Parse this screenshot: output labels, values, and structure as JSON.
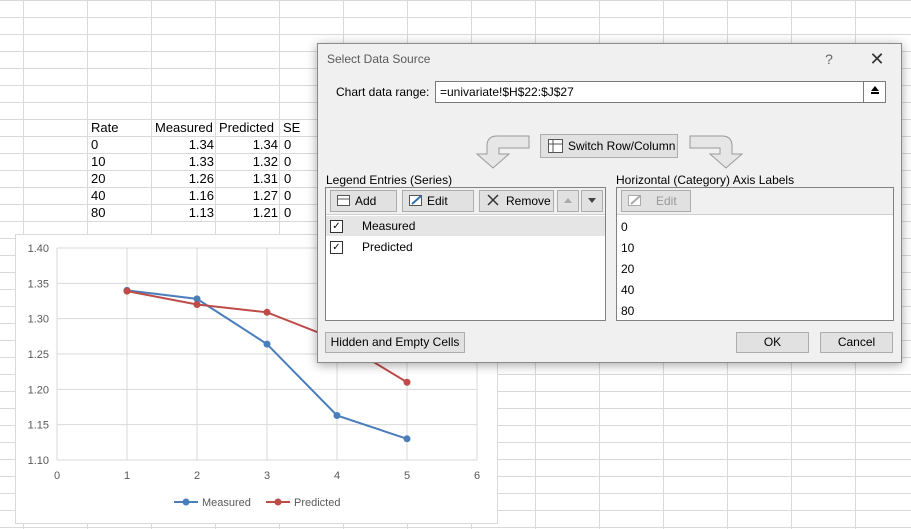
{
  "spreadsheet": {
    "headers": [
      "Rate",
      "Measured",
      "Predicted",
      "SE"
    ],
    "rows": [
      {
        "rate": "0",
        "measured": "1.34",
        "predicted": "1.34",
        "se": "0"
      },
      {
        "rate": "10",
        "measured": "1.33",
        "predicted": "1.32",
        "se": "0"
      },
      {
        "rate": "20",
        "measured": "1.26",
        "predicted": "1.31",
        "se": "0"
      },
      {
        "rate": "40",
        "measured": "1.16",
        "predicted": "1.27",
        "se": "0"
      },
      {
        "rate": "80",
        "measured": "1.13",
        "predicted": "1.21",
        "se": "0"
      }
    ]
  },
  "chart_data": {
    "type": "line",
    "x_ticks": [
      "0",
      "1",
      "2",
      "3",
      "4",
      "5",
      "6"
    ],
    "y_ticks": [
      "1.40",
      "1.35",
      "1.30",
      "1.25",
      "1.20",
      "1.15",
      "1.10"
    ],
    "xlim": [
      0,
      6
    ],
    "ylim": [
      1.1,
      1.4
    ],
    "grid": true,
    "legend": "bottom",
    "series": [
      {
        "name": "Measured",
        "color": "#4a7ebb",
        "x": [
          1,
          2,
          3,
          4,
          5
        ],
        "y": [
          1.34,
          1.328,
          1.264,
          1.163,
          1.13
        ]
      },
      {
        "name": "Predicted",
        "color": "#be4b48",
        "x": [
          1,
          2,
          3,
          4,
          5
        ],
        "y": [
          1.339,
          1.32,
          1.309,
          1.27,
          1.21
        ]
      }
    ]
  },
  "dialog": {
    "title": "Select Data Source",
    "help": "?",
    "close": "✕",
    "range_label": "Chart data range:",
    "range_value": "=univariate!$H$22:$J$27",
    "switch_label": "Switch Row/Column",
    "legend_label": "Legend Entries (Series)",
    "add_label": "Add",
    "edit_label": "Edit",
    "remove_label": "Remove",
    "series_items": [
      "Measured",
      "Predicted"
    ],
    "axis_label": "Horizontal (Category) Axis Labels",
    "axis_edit_label": "Edit",
    "axis_items": [
      "0",
      "10",
      "20",
      "40",
      "80"
    ],
    "hidden_cells_label": "Hidden and Empty Cells",
    "ok_label": "OK",
    "cancel_label": "Cancel"
  }
}
